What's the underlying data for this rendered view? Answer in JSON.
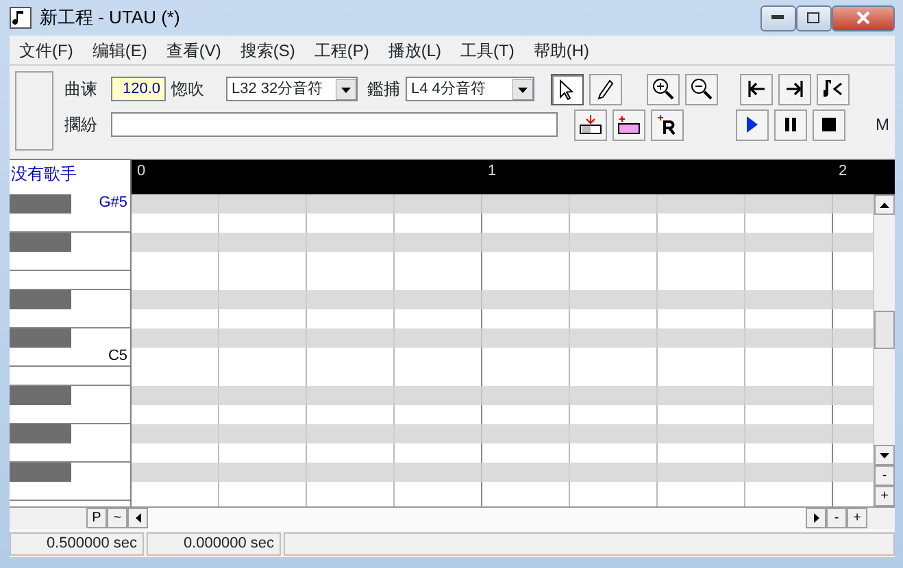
{
  "window": {
    "title": "新工程 - UTAU (*)"
  },
  "menu": [
    "文件(F)",
    "编辑(E)",
    "查看(V)",
    "搜索(S)",
    "工程(P)",
    "播放(L)",
    "工具(T)",
    "帮助(H)"
  ],
  "toolbar": {
    "tempo_label": "曲谏",
    "tempo": "120.0",
    "tempo_unit": "惚吹",
    "quantize": "L32 32分音符",
    "length_label": "鑑捕",
    "length": "L4  4分音符",
    "lyric_label": "擱紛",
    "tool_buttons": [
      {
        "kind": "select",
        "selected": true
      },
      {
        "kind": "pencil",
        "selected": false
      }
    ],
    "cut_text": "M"
  },
  "singer": "没有歌手",
  "ruler": [
    "0",
    "1",
    "2"
  ],
  "keys": [
    {
      "black": true,
      "label": "G#5"
    },
    {
      "black": false
    },
    {
      "black": true
    },
    {
      "black": false
    },
    {
      "black": false
    },
    {
      "black": true
    },
    {
      "black": false
    },
    {
      "black": true
    },
    {
      "black": false,
      "label": "C5"
    },
    {
      "black": false
    },
    {
      "black": true
    },
    {
      "black": false
    },
    {
      "black": true
    },
    {
      "black": false
    },
    {
      "black": true
    },
    {
      "black": false
    }
  ],
  "scroll_buttons": [
    "P",
    "~"
  ],
  "zoom_buttons": [
    "-",
    "+"
  ],
  "status": [
    "0.500000 sec",
    "0.000000 sec"
  ]
}
